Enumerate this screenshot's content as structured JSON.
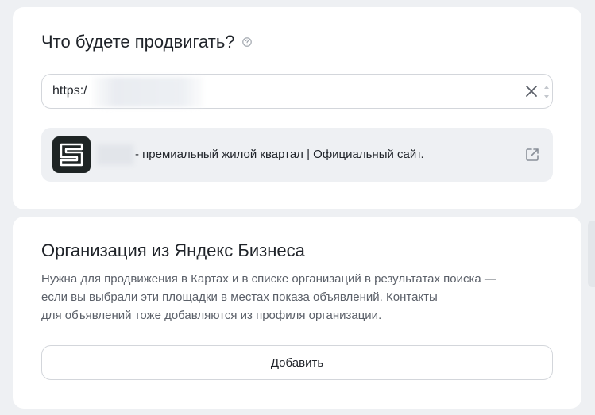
{
  "promote_section": {
    "title": "Что будете продвигать?",
    "help_icon": "question-circle-icon",
    "url_field": {
      "value": "https:/",
      "placeholder": ""
    },
    "clear_icon": "close-icon",
    "site_preview": {
      "favicon": "site-logo-icon",
      "description": "- премиальный жилой квартал | Официальный сайт.",
      "external_icon": "external-link-icon"
    }
  },
  "org_section": {
    "title": "Организация из Яндекс Бизнеса",
    "description_lines": [
      "Нужна для продвижения в Картах и в списке организаций в результатах поиска —",
      "если вы выбрали эти площадки в местах показа объявлений. Контакты",
      "для объявлений тоже добавляются из профиля организации."
    ],
    "add_button_label": "Добавить"
  },
  "colors": {
    "background": "#eef0f3",
    "card": "#ffffff",
    "text": "#1f2329",
    "muted_text": "#5b6069",
    "border": "#d3d6db",
    "preview_bg": "#eef0f3",
    "favicon_bg": "#1e2424"
  }
}
